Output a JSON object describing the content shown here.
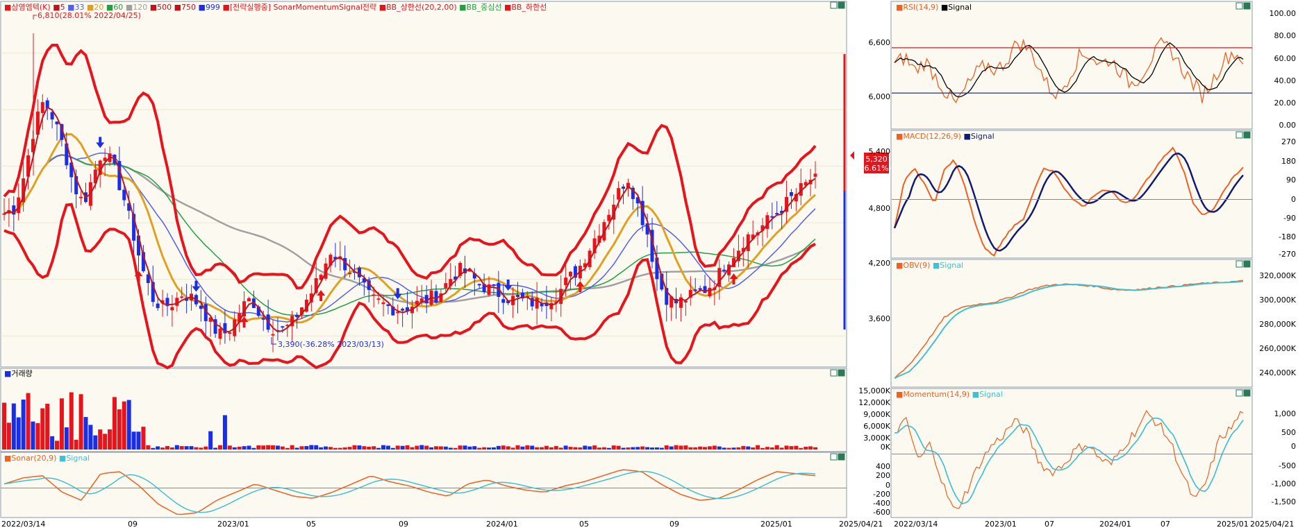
{
  "main_panel": {
    "legend": {
      "symbol": "삼영엠텍(K)",
      "ma_periods": [
        "5",
        "33",
        "20",
        "60",
        "120",
        "500",
        "750",
        "999"
      ],
      "strategy": "[전략실행중] SonarMomentumSignal전략",
      "bb_upper": "BB_상한선(20,2,00)",
      "bb_middle": "BB_중심선",
      "bb_lower": "BB_하한선"
    },
    "high_annotation": "6,810(28.01% 2022/04/25)",
    "low_annotation": "3,390(-36.28% 2023/03/13)",
    "price_box": {
      "price": "5,320",
      "change": "(6.61%)"
    },
    "price_ticks": [
      "6,600",
      "6,000",
      "5,400",
      "4,800",
      "4,200",
      "3,600"
    ],
    "date_ticks": [
      "2022/03/14",
      "09",
      "2023/01",
      "05",
      "09",
      "2024/01",
      "05",
      "09",
      "2025/01",
      "2025/04/21"
    ]
  },
  "volume_panel": {
    "title": "거래량",
    "ticks": [
      "15,000K",
      "12,000K",
      "9,000K",
      "6,000K",
      "3,000K",
      "0K"
    ]
  },
  "sonar_panel": {
    "title": "Sonar(20,9)",
    "signal": "Signal",
    "ticks": [
      "400",
      "200",
      "0",
      "-200",
      "-400",
      "-600"
    ]
  },
  "rsi_panel": {
    "title": "RSI(14,9)",
    "signal": "Signal",
    "ticks": [
      "100.00",
      "80.00",
      "60.00",
      "40.00",
      "20.00",
      "0.00"
    ]
  },
  "macd_panel": {
    "title": "MACD(12,26,9)",
    "signal": "Signal",
    "ticks": [
      "270",
      "180",
      "90",
      "0",
      "-90",
      "-180",
      "-270"
    ]
  },
  "obv_panel": {
    "title": "OBV(9)",
    "signal": "Signal",
    "ticks": [
      "320,000K",
      "300,000K",
      "280,000K",
      "260,000K",
      "240,000K"
    ]
  },
  "momentum_panel": {
    "title": "Momentum(14,9)",
    "signal": "Signal",
    "ticks": [
      "1,000",
      "500",
      "0",
      "-500",
      "-1,000",
      "-1,500"
    ]
  },
  "right_date_ticks": [
    "2022/03/14",
    "2023/01",
    "07",
    "2024/01",
    "07",
    "2025/01",
    "2025/04/21"
  ],
  "colors": {
    "up": "#e8141c",
    "down": "#1a2ee8",
    "bb": "#e8141c",
    "ma5": "#c0141c",
    "ma20": "#e0a020",
    "ma33": "#5060f0",
    "ma60": "#20a040",
    "ma120": "#1a7a28",
    "ma500": "#a0a0a0",
    "orange": "#f06020",
    "cyan": "#40c0d0",
    "navy": "#101a70"
  },
  "chart_data": [
    {
      "type": "candlestick",
      "title": "삼영엠텍(K)",
      "x_range": [
        "2022/03/14",
        "2025/04/21"
      ],
      "ylim": [
        3300,
        7000
      ],
      "points": [
        4900,
        4950,
        5300,
        5800,
        6100,
        5900,
        5600,
        5200,
        5000,
        5300,
        5600,
        5400,
        5100,
        4700,
        4300,
        4000,
        3900,
        3950,
        4050,
        4000,
        3900,
        3700,
        3600,
        3700,
        3900,
        4000,
        3800,
        3700,
        3650,
        3720,
        3900,
        4050,
        4250,
        4500,
        4400,
        4300,
        4150,
        4000,
        3950,
        3900,
        3880,
        3920,
        3950,
        4000,
        4050,
        4200,
        4300,
        4250,
        4150,
        4100,
        4050,
        4000,
        3980,
        3960,
        3950,
        4000,
        4050,
        4200,
        4300,
        4500,
        4700,
        4900,
        5100,
        5300,
        5000,
        4700,
        4200,
        4000,
        3950,
        4000,
        4050,
        4100,
        4200,
        4400,
        4500,
        4650,
        4700,
        4800,
        4900,
        5000,
        5100,
        5200,
        5320
      ],
      "annotations": [
        {
          "label": "6,810(28.01% 2022/04/25)",
          "x": "2022/04/25",
          "y": 6810
        },
        {
          "label": "3,390(-36.28% 2023/03/13)",
          "x": "2023/03/13",
          "y": 3390
        }
      ],
      "last_price": 5320,
      "last_change_pct": 6.61
    },
    {
      "type": "bar",
      "title": "거래량",
      "ylim": [
        0,
        16000
      ],
      "unit": "K"
    },
    {
      "type": "line",
      "title": "Sonar(20,9)",
      "ylim": [
        -700,
        600
      ]
    },
    {
      "type": "line",
      "title": "RSI(14,9)",
      "ylim": [
        0,
        100
      ],
      "reference_lines": [
        70,
        30
      ]
    },
    {
      "type": "line",
      "title": "MACD(12,26,9)",
      "ylim": [
        -290,
        290
      ]
    },
    {
      "type": "line",
      "title": "OBV(9)",
      "ylim": [
        225000,
        330000
      ],
      "unit": "K"
    },
    {
      "type": "line",
      "title": "Momentum(14,9)",
      "ylim": [
        -1700,
        1400
      ]
    }
  ]
}
